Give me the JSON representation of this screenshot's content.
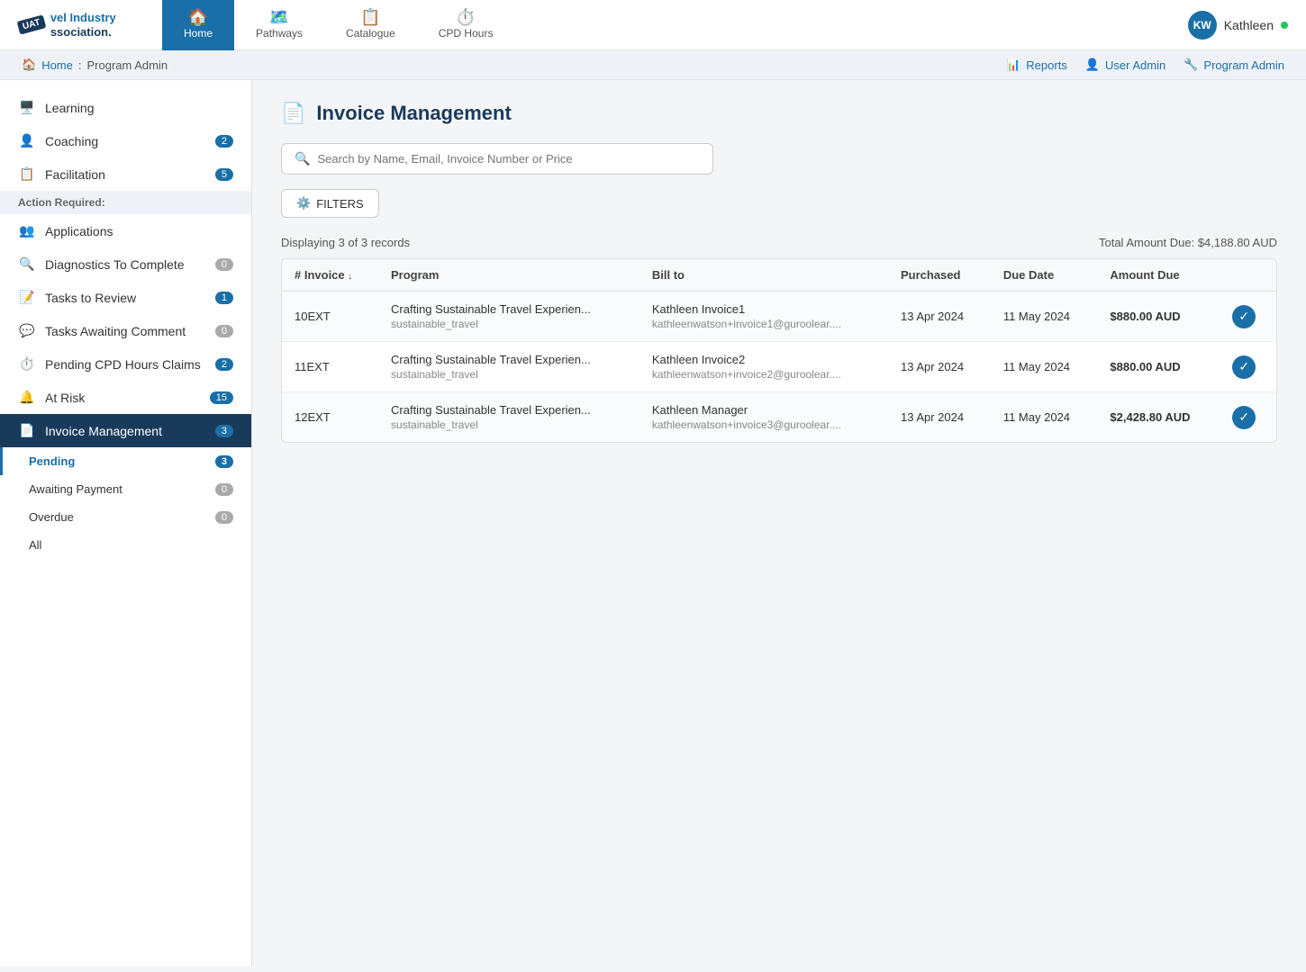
{
  "nav": {
    "logo_badge": "UAT",
    "logo_line1": "vel Industry",
    "logo_line2": "ssociation.",
    "items": [
      {
        "label": "Home",
        "icon": "🏠",
        "active": true
      },
      {
        "label": "Pathways",
        "icon": "🗺️",
        "active": false
      },
      {
        "label": "Catalogue",
        "icon": "📋",
        "active": false
      },
      {
        "label": "CPD Hours",
        "icon": "⏱️",
        "active": false
      }
    ],
    "user_initials": "KW",
    "user_name": "Kathleen"
  },
  "breadcrumb": {
    "home": "Home",
    "current": "Program Admin",
    "actions": [
      {
        "label": "Reports",
        "icon": "📊"
      },
      {
        "label": "User Admin",
        "icon": "👤"
      },
      {
        "label": "Program Admin",
        "icon": "🔧"
      }
    ]
  },
  "sidebar": {
    "items": [
      {
        "label": "Learning",
        "icon": "🖥️",
        "badge": null,
        "active": false
      },
      {
        "label": "Coaching",
        "icon": "👤",
        "badge": "2",
        "active": false
      },
      {
        "label": "Facilitation",
        "icon": "📋",
        "badge": "5",
        "active": false
      }
    ],
    "section_header": "Action Required:",
    "action_items": [
      {
        "label": "Applications",
        "icon": "👥",
        "badge": null,
        "active": false
      },
      {
        "label": "Diagnostics To Complete",
        "icon": "🔍",
        "badge": "0",
        "active": false
      },
      {
        "label": "Tasks to Review",
        "icon": "📝",
        "badge": "1",
        "active": false
      },
      {
        "label": "Tasks Awaiting Comment",
        "icon": "💬",
        "badge": "0",
        "active": false
      },
      {
        "label": "Pending CPD Hours Claims",
        "icon": "⏱️",
        "badge": "2",
        "active": false
      },
      {
        "label": "At Risk",
        "icon": "🔔",
        "badge": "15",
        "active": false
      },
      {
        "label": "Invoice Management",
        "icon": "📄",
        "badge": "3",
        "active": true
      }
    ],
    "sub_items": [
      {
        "label": "Pending",
        "badge": "3",
        "active": true
      },
      {
        "label": "Awaiting Payment",
        "badge": "0",
        "active": false
      },
      {
        "label": "Overdue",
        "badge": "0",
        "active": false
      },
      {
        "label": "All",
        "badge": null,
        "active": false
      }
    ]
  },
  "page": {
    "title": "Invoice Management",
    "icon": "📄",
    "search_placeholder": "Search by Name, Email, Invoice Number or Price",
    "filters_label": "FILTERS",
    "display_text": "Displaying 3 of 3 records",
    "total_amount": "Total Amount Due: $4,188.80 AUD",
    "columns": [
      "# Invoice",
      "Program",
      "Bill to",
      "Purchased",
      "Due Date",
      "Amount Due"
    ],
    "rows": [
      {
        "invoice_num": "10EXT",
        "program": "Crafting Sustainable Travel Experien...",
        "program_sub": "sustainable_travel",
        "bill_name": "Kathleen Invoice1",
        "bill_email": "kathleenwatson+invoice1@guroolear....",
        "purchased": "13 Apr 2024",
        "due_date": "11 May 2024",
        "amount": "$880.00 AUD"
      },
      {
        "invoice_num": "11EXT",
        "program": "Crafting Sustainable Travel Experien...",
        "program_sub": "sustainable_travel",
        "bill_name": "Kathleen Invoice2",
        "bill_email": "kathleenwatson+invoice2@guroolear....",
        "purchased": "13 Apr 2024",
        "due_date": "11 May 2024",
        "amount": "$880.00 AUD"
      },
      {
        "invoice_num": "12EXT",
        "program": "Crafting Sustainable Travel Experien...",
        "program_sub": "sustainable_travel",
        "bill_name": "Kathleen Manager",
        "bill_email": "kathleenwatson+invoice3@guroolear....",
        "purchased": "13 Apr 2024",
        "due_date": "11 May 2024",
        "amount": "$2,428.80 AUD"
      }
    ]
  }
}
